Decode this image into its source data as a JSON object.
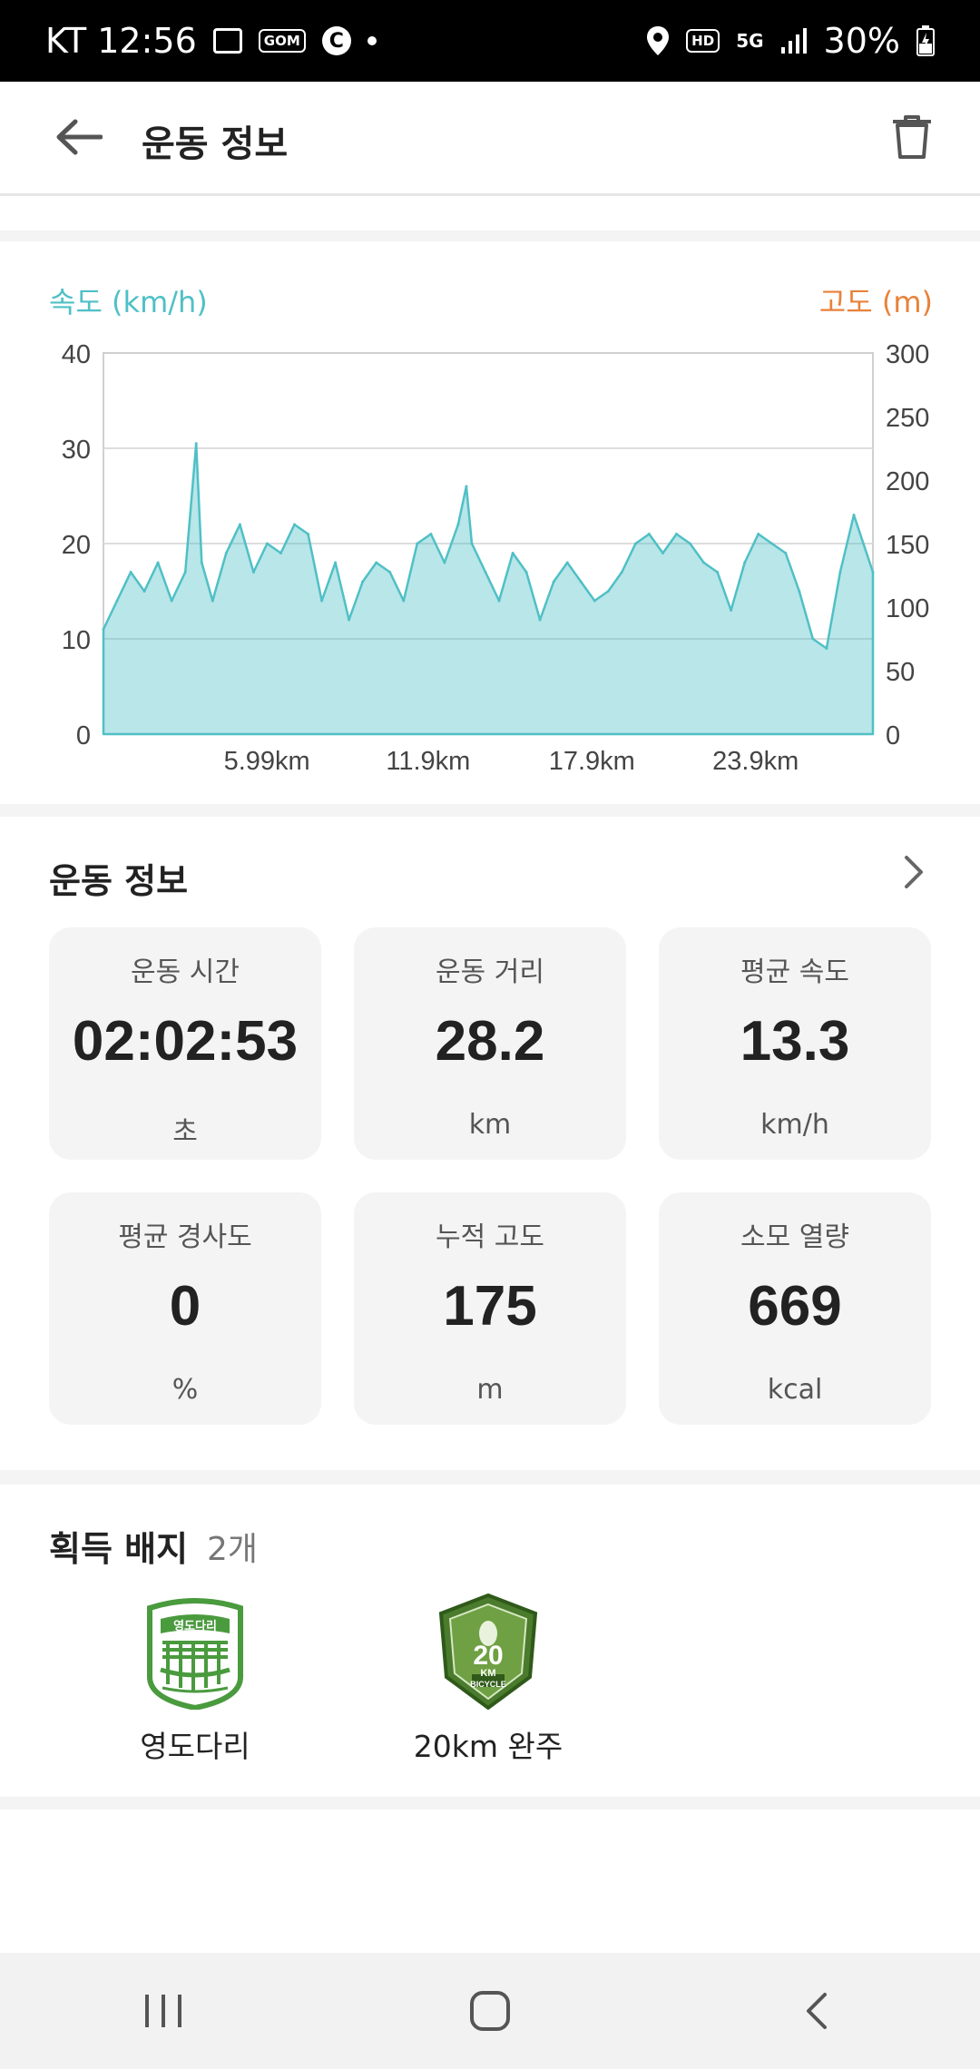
{
  "status_bar": {
    "carrier_time": "KT 12:56",
    "gallery_icon": "image-icon",
    "gom_label": "GOM",
    "c_label": "C",
    "hd_label": "HD",
    "net_label": "5G",
    "battery": "30%"
  },
  "app_bar": {
    "title": "운동 정보"
  },
  "chart": {
    "legend_left": "속도 (km/h)",
    "legend_right": "고도 (m)",
    "speed_color": "#4fc0c6",
    "altitude_color": "#e8823a"
  },
  "chart_data": {
    "type": "area",
    "title": "",
    "xlabel": "",
    "ylabel": "속도 (km/h)",
    "y2label": "고도 (m)",
    "ylim": [
      0,
      40
    ],
    "y2lim": [
      0,
      300
    ],
    "y_ticks": [
      "0",
      "10",
      "20",
      "30",
      "40"
    ],
    "y2_ticks": [
      "0",
      "50",
      "100",
      "150",
      "200",
      "250",
      "300"
    ],
    "x_ticks": [
      "5.99km",
      "11.9km",
      "17.9km",
      "23.9km"
    ],
    "x_tick_values": [
      5.99,
      11.9,
      17.9,
      23.9
    ],
    "xlim": [
      0,
      28.2
    ],
    "grid": true,
    "series": [
      {
        "name": "속도 (km/h)",
        "x": [
          0,
          0.5,
          1.0,
          1.5,
          2.0,
          2.5,
          3.0,
          3.4,
          3.6,
          4.0,
          4.5,
          5.0,
          5.5,
          6.0,
          6.5,
          7.0,
          7.5,
          8.0,
          8.5,
          9.0,
          9.5,
          10.0,
          10.5,
          11.0,
          11.5,
          12.0,
          12.5,
          13.0,
          13.3,
          13.5,
          14.0,
          14.5,
          15.0,
          15.5,
          16.0,
          16.5,
          17.0,
          17.5,
          18.0,
          18.5,
          19.0,
          19.5,
          20.0,
          20.5,
          21.0,
          21.5,
          22.0,
          22.5,
          23.0,
          23.5,
          24.0,
          24.5,
          25.0,
          25.5,
          26.0,
          26.5,
          27.0,
          27.5,
          28.2
        ],
        "values": [
          11,
          14,
          17,
          15,
          18,
          14,
          17,
          30.5,
          18,
          14,
          19,
          22,
          17,
          20,
          19,
          22,
          21,
          14,
          18,
          12,
          16,
          18,
          17,
          14,
          20,
          21,
          18,
          22,
          26,
          20,
          17,
          14,
          19,
          17,
          12,
          16,
          18,
          16,
          14,
          15,
          17,
          20,
          21,
          19,
          21,
          20,
          18,
          17,
          13,
          18,
          21,
          20,
          19,
          15,
          10,
          9,
          17,
          23,
          17
        ]
      }
    ]
  },
  "workout_info": {
    "header": "운동 정보",
    "stats": [
      {
        "label": "운동 시간",
        "value": "02:02:53",
        "unit": "초"
      },
      {
        "label": "운동 거리",
        "value": "28.2",
        "unit": "km"
      },
      {
        "label": "평균 속도",
        "value": "13.3",
        "unit": "km/h"
      },
      {
        "label": "평균 경사도",
        "value": "0",
        "unit": "%"
      },
      {
        "label": "누적 고도",
        "value": "175",
        "unit": "m"
      },
      {
        "label": "소모 열량",
        "value": "669",
        "unit": "kcal"
      }
    ]
  },
  "badges": {
    "header": "획득 배지",
    "count": "2개",
    "items": [
      {
        "label": "영도다리",
        "icon": "bridge-badge-icon",
        "emblem_text": "영도다리"
      },
      {
        "label": "20km 완주",
        "icon": "bicycle-badge-icon",
        "emblem_number": "20",
        "emblem_unit": "KM",
        "emblem_text": "BICYCLE"
      }
    ]
  },
  "nav": {
    "recent": "recent-apps-icon",
    "home": "home-icon",
    "back": "back-icon"
  }
}
